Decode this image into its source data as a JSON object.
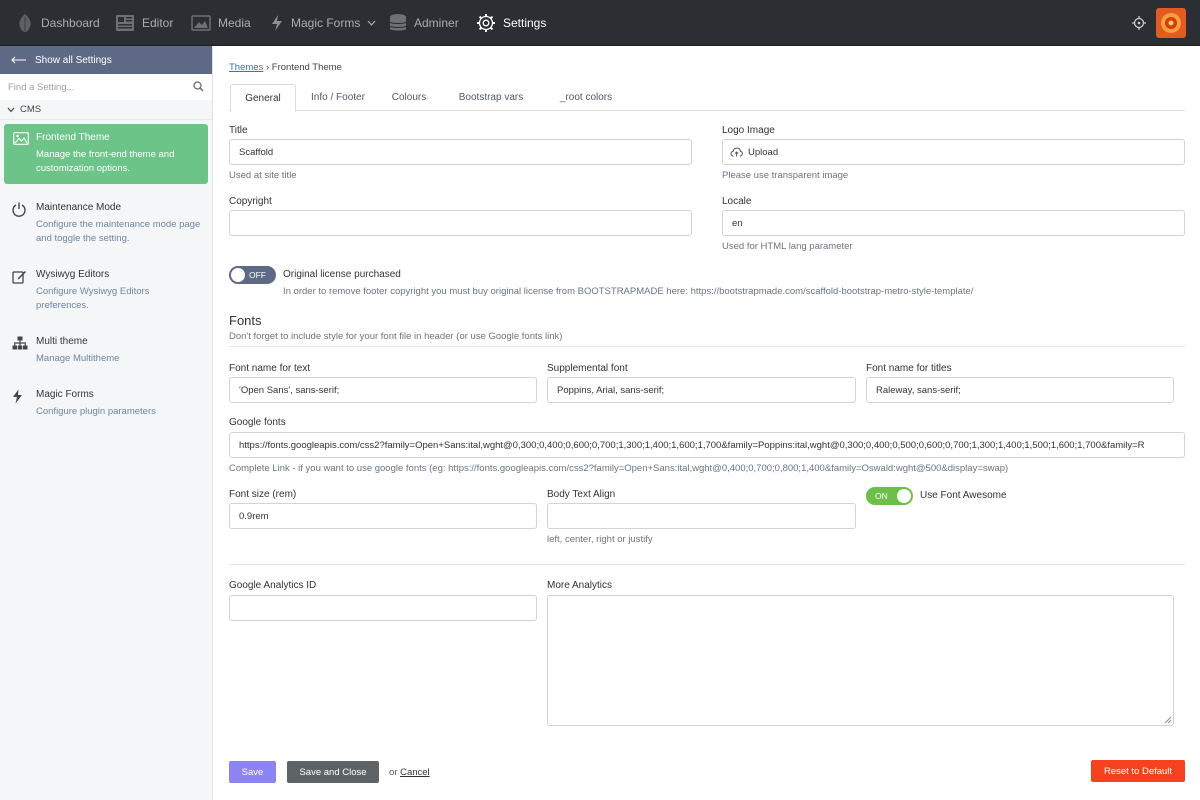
{
  "topnav": {
    "items": [
      {
        "label": "Dashboard",
        "icon": "leaf-icon"
      },
      {
        "label": "Editor",
        "icon": "newspaper-icon"
      },
      {
        "label": "Media",
        "icon": "image-icon"
      },
      {
        "label": "Magic Forms",
        "icon": "bolt-icon",
        "has_dropdown": true
      },
      {
        "label": "Adminer",
        "icon": "database-icon"
      },
      {
        "label": "Settings",
        "icon": "gear-icon",
        "active": true
      }
    ],
    "right_icons": [
      "crosshair-icon",
      "user-avatar"
    ]
  },
  "sidebar": {
    "show_all": "Show all Settings",
    "search_placeholder": "Find a Setting...",
    "group": "CMS",
    "items": [
      {
        "title": "Frontend Theme",
        "desc": "Manage the front-end theme and customization options.",
        "icon": "picture-icon",
        "active": true
      },
      {
        "title": "Maintenance Mode",
        "desc": "Configure the maintenance mode page and toggle the setting.",
        "icon": "power-icon"
      },
      {
        "title": "Wysiwyg Editors",
        "desc": "Configure Wysiwyg Editors preferences.",
        "icon": "edit-icon"
      },
      {
        "title": "Multi theme",
        "desc": "Manage Multitheme",
        "icon": "sitemap-icon"
      },
      {
        "title": "Magic Forms",
        "desc": "Configure plugin parameters",
        "icon": "bolt-icon"
      }
    ]
  },
  "breadcrumb": {
    "link": "Themes",
    "sep": "›",
    "current": "Frontend Theme"
  },
  "tabs": [
    "General",
    "Info / Footer",
    "Colours",
    "Bootstrap vars",
    "_root colors"
  ],
  "form": {
    "title": {
      "label": "Title",
      "value": "Scaffold",
      "help": "Used at site title"
    },
    "logo": {
      "label": "Logo Image",
      "button": "Upload",
      "help": "Please use transparent image"
    },
    "copyright": {
      "label": "Copyright",
      "value": ""
    },
    "locale": {
      "label": "Locale",
      "value": "en",
      "help": "Used for HTML lang parameter"
    },
    "license": {
      "state": "OFF",
      "label": "Original license purchased",
      "help": "In order to remove footer copyright you must buy original license from BOOTSTRAPMADE here: https://bootstrapmade.com/scaffold-bootstrap-metro-style-template/"
    },
    "fonts": {
      "heading": "Fonts",
      "help": "Don't forget to include style for your font file in header (or use Google fonts link)",
      "text_font": {
        "label": "Font name for text",
        "value": "'Open Sans', sans-serif;"
      },
      "supplemental": {
        "label": "Supplemental font",
        "value": "Poppins, Arial, sans-serif;"
      },
      "titles_font": {
        "label": "Font name for titles",
        "value": "Raleway, sans-serif;"
      },
      "google": {
        "label": "Google fonts",
        "value": "https://fonts.googleapis.com/css2?family=Open+Sans:ital,wght@0,300;0,400;0,600;0,700;1,300;1,400;1,600;1,700&family=Poppins:ital,wght@0,300;0,400;0,500;0,600;0,700;1,300;1,400;1,500;1,600;1,700&family=R",
        "help": "Complete Link - if you want to use google fonts (eg: https://fonts.googleapis.com/css2?family=Open+Sans:ital,wght@0,400;0,700;0,800;1,400&family=Oswald:wght@500&display=swap)"
      },
      "size": {
        "label": "Font size (rem)",
        "value": "0.9rem"
      },
      "align": {
        "label": "Body Text Align",
        "value": "",
        "help": "left, center, right or justify"
      },
      "awesome": {
        "state": "ON",
        "label": "Use Font Awesome"
      }
    },
    "analytics": {
      "label": "Google Analytics ID",
      "value": ""
    },
    "more_analytics": {
      "label": "More Analytics",
      "value": ""
    }
  },
  "buttons": {
    "save": "Save",
    "save_close": "Save and Close",
    "or": "or",
    "cancel": "Cancel",
    "reset": "Reset to Default"
  },
  "colors": {
    "topbar": "#2b2f33",
    "accent_green": "#6cc489",
    "save": "#8b84f2",
    "reset": "#f6411e",
    "toggle_on": "#6cc04a",
    "toggle_off": "#5e6a85"
  }
}
